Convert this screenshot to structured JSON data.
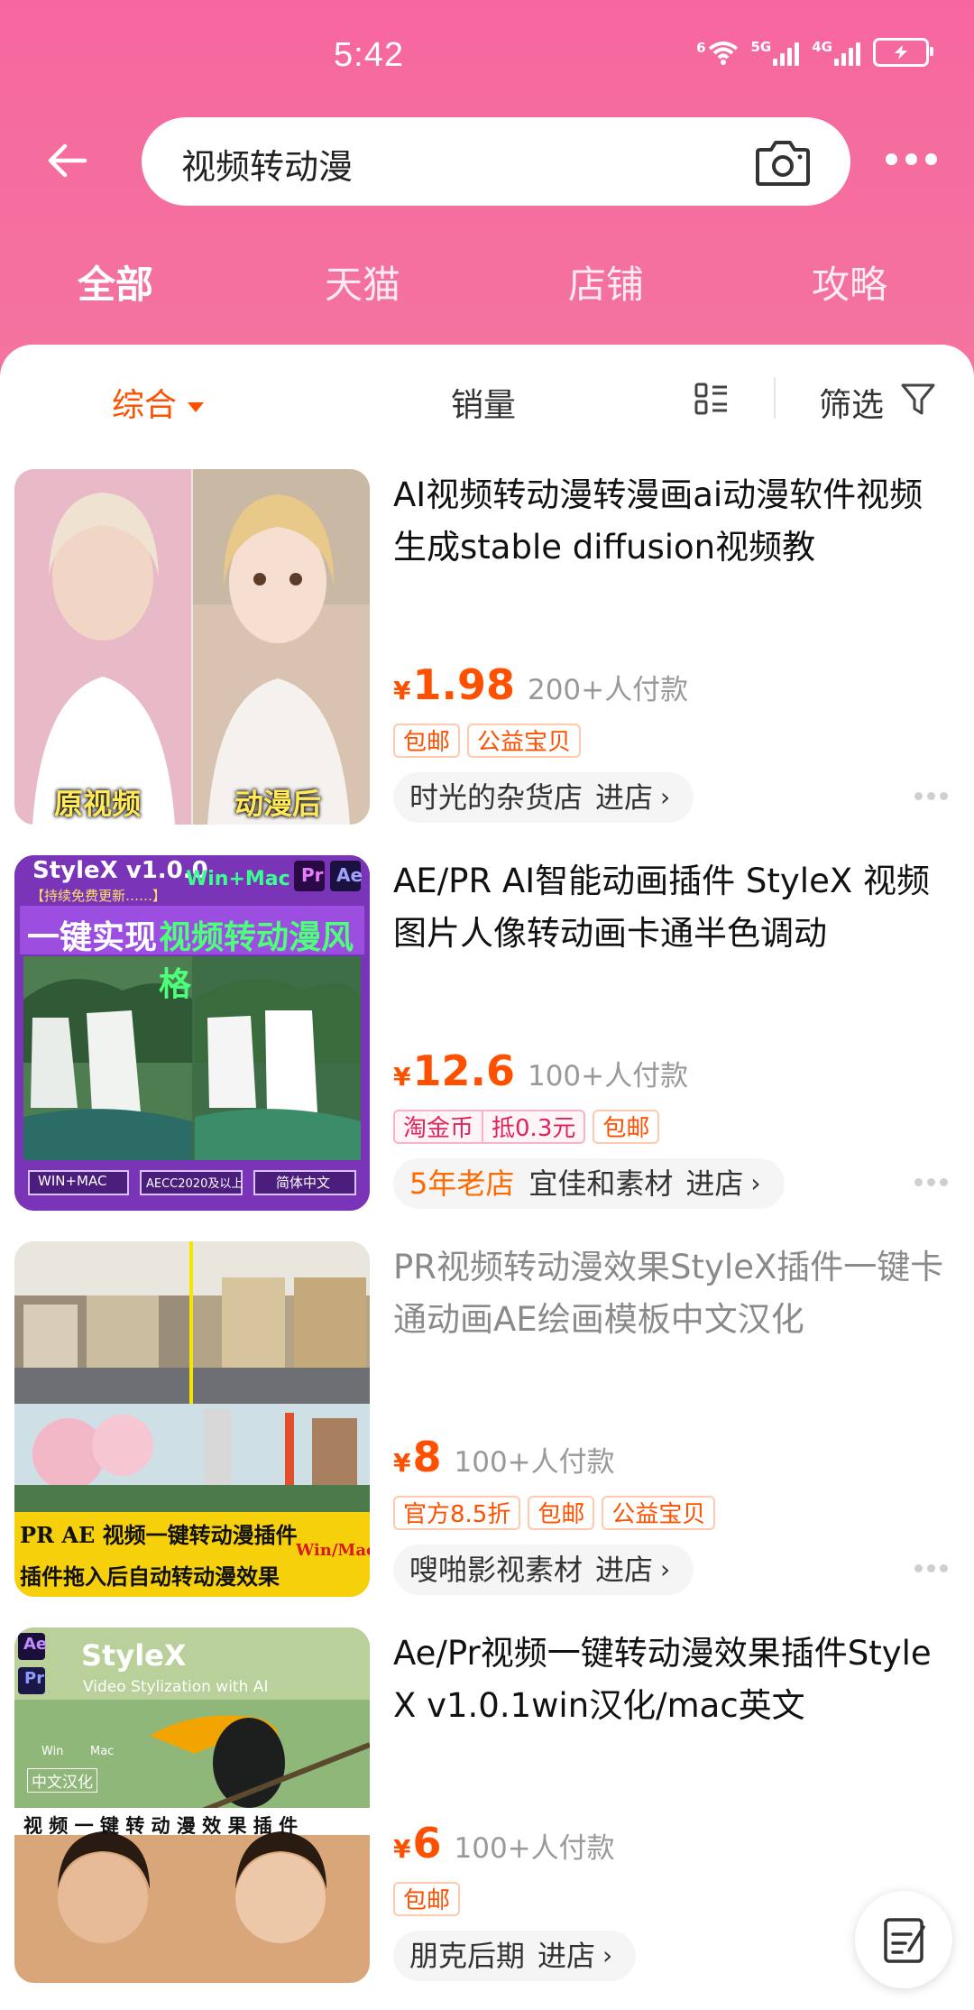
{
  "status_bar": {
    "time": "5:42",
    "wifi_label": "6",
    "sim1_label": "5G",
    "sim2_label": "4G"
  },
  "search": {
    "query": "视频转动漫"
  },
  "tabs": [
    "全部",
    "天猫",
    "店铺",
    "攻略"
  ],
  "sort_bar": {
    "comprehensive": "综合",
    "sales": "销量",
    "filter": "筛选"
  },
  "products": [
    {
      "title": "AI视频转动漫转漫画ai动漫软件视频生成stable diffusion视频教",
      "currency": "¥",
      "price": "1.98",
      "sales": "200+人付款",
      "tags": [
        "包邮",
        "公益宝贝"
      ],
      "shop": "时光的杂货店",
      "enter": "进店",
      "thumb_captions": [
        "原视频",
        "动漫后"
      ]
    },
    {
      "title": "AE/PR AI智能动画插件 StyleX 视频图片人像转动画卡通半色调动",
      "currency": "¥",
      "price": "12.6",
      "sales": "100+人付款",
      "tags": [
        "淘金币",
        "抵0.3元",
        "包邮"
      ],
      "shop_badge": "5年老店",
      "shop": "宜佳和素材",
      "enter": "进店",
      "thumb_texts": [
        "StyleX v1.0.0",
        "【持续免费更新……】",
        "Win+Mac",
        "Pr",
        "Ae",
        "一键实现",
        "视频转动漫风格",
        "WIN+MAC",
        "AECC2020及以上",
        "简体中文"
      ]
    },
    {
      "title": "PR视频转动漫效果StyleX插件一键卡通动画AE绘画模板中文汉化",
      "currency": "¥",
      "price": "8",
      "sales": "100+人付款",
      "tags": [
        "官方8.5折",
        "包邮",
        "公益宝贝"
      ],
      "shop": "嗖啪影视素材",
      "enter": "进店",
      "thumb_texts": [
        "PR AE 视频一键转动漫插件",
        "Win/Mac",
        "插件拖入后自动转动漫效果"
      ]
    },
    {
      "title": "Ae/Pr视频一键转动漫效果插件StyleX v1.0.1win汉化/mac英文",
      "currency": "¥",
      "price": "6",
      "sales": "100+人付款",
      "tags": [
        "包邮"
      ],
      "shop": "朋克后期",
      "enter": "进店",
      "thumb_texts": [
        "Ae",
        "Pr",
        "StyleX",
        "Video Stylization with AI",
        "Win",
        "Mac",
        "中文汉化",
        "视 频 一 键 转 动 漫 效 果 插 件"
      ]
    }
  ],
  "colors": {
    "header_pink": "#f6679f",
    "accent_orange": "#ff5000"
  }
}
